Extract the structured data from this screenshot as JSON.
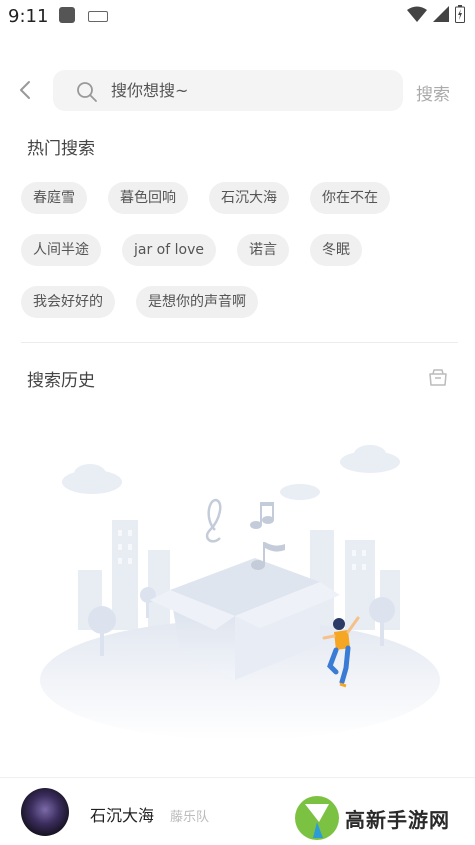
{
  "status_bar": {
    "time": "9:11"
  },
  "search": {
    "placeholder": "搜你想搜~",
    "button_label": "搜索"
  },
  "hot_search": {
    "title": "热门搜索",
    "rows": [
      [
        "春庭雪",
        "暮色回响",
        "石沉大海",
        "你在不在"
      ],
      [
        "人间半途",
        "jar of love",
        "诺言",
        "冬眠"
      ],
      [
        "我会好好的",
        "是想你的声音啊"
      ]
    ]
  },
  "history": {
    "title": "搜索历史"
  },
  "player": {
    "song_title": "石沉大海",
    "artist": "藤乐队"
  },
  "watermark": {
    "text": "高新手游网"
  },
  "colors": {
    "tag_bg": "#f0f0f0",
    "search_bg": "#f4f4f4",
    "dancer_shirt": "#f5a623",
    "dancer_pants": "#3a7bd5"
  }
}
